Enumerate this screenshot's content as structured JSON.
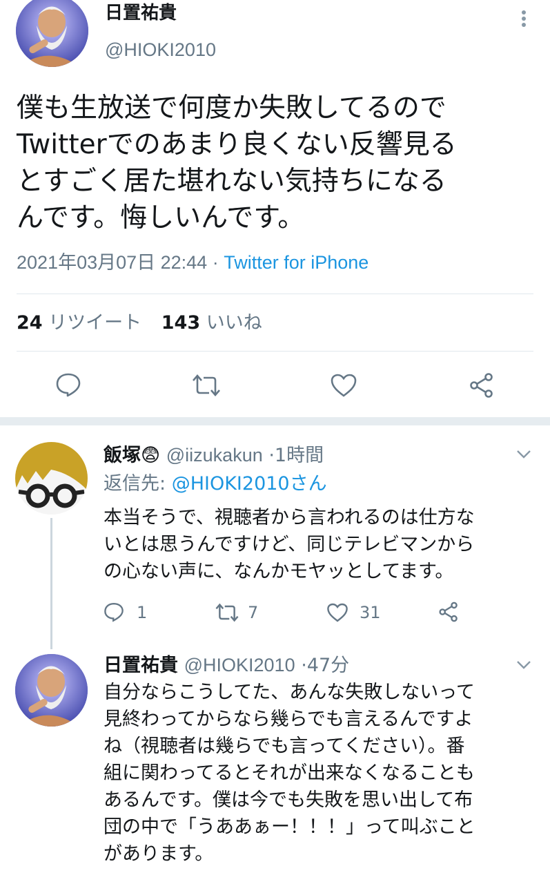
{
  "main_tweet": {
    "display_name": "日置祐貴",
    "handle": "@HIOKI2010",
    "text_lines": [
      "僕も生放送で何度か失敗してるので",
      "Twitterでのあまり良くない反響見る",
      "とすごく居た堪れない気持ちになる",
      "んです。悔しいんです。"
    ],
    "timestamp": "2021年03月07日 22:44",
    "separator": "·",
    "source": "Twitter for iPhone",
    "retweet_count": "24",
    "retweet_label": "リツイート",
    "like_count": "143",
    "like_label": "いいね",
    "avatar_icon": "zeus-avatar-icon"
  },
  "replies": [
    {
      "display_name": "飯塚",
      "emoji": "😨",
      "handle": "@iizukakun",
      "separator": "·",
      "time": "1時間",
      "reply_to_prefix": "返信先:",
      "reply_to_handle": "@HIOKI2010さん",
      "text_lines": [
        "本当そうで、視聴者から言われるのは仕方な",
        "いとは思うんですけど、同じテレビマンから",
        "の心ない声に、なんかモヤッとしてます。"
      ],
      "reply_count": "1",
      "retweet_count": "7",
      "like_count": "31",
      "avatar_icon": "glasses-avatar-icon"
    },
    {
      "display_name": "日置祐貴",
      "handle": "@HIOKI2010",
      "separator": "·",
      "time": "47分",
      "text_lines": [
        "自分ならこうしてた、あんな失敗しないって",
        "見終わってからなら幾らでも言えるんですよ",
        "ね（視聴者は幾らでも言ってください）。番",
        "組に関わってるとそれが出来なくなることも",
        "あるんです。僕は今でも失敗を思い出して布",
        "団の中で「うああぁー！！！」って叫ぶこと",
        "があります。"
      ],
      "avatar_icon": "zeus-avatar-icon"
    }
  ],
  "colors": {
    "accent": "#1b95e0",
    "muted": "#657786",
    "divider": "#e1e8ed"
  }
}
